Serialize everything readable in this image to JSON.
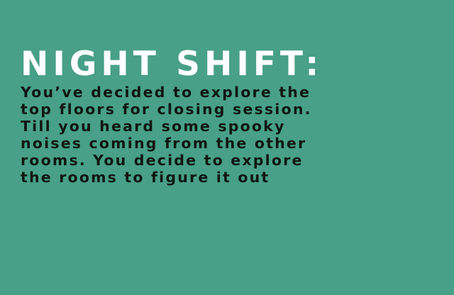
{
  "screen": {
    "title": "NIGHT SHIFT:",
    "story_lines": [
      "You’ve decided to explore the",
      "top floors for closing session.",
      "Till you heard some spooky",
      "noises coming from the other",
      "rooms. You decide to explore",
      "the rooms to figure it out"
    ]
  },
  "colors": {
    "background": "#47a087",
    "title_text": "#ffffff",
    "story_text": "#101612"
  }
}
